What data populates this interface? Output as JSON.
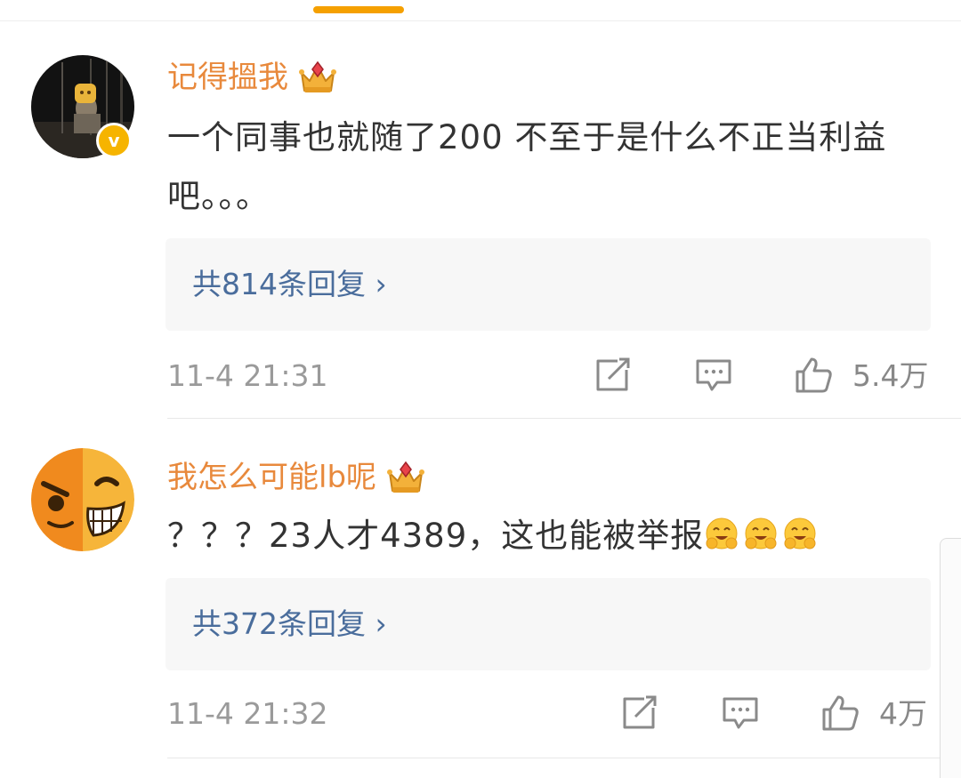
{
  "comments": [
    {
      "username": "记得搵我",
      "text": "一个同事也就随了200 不至于是什么不正当利益吧。。。",
      "replies_label": "共814条回复 ›",
      "timestamp": "11-4 21:31",
      "likes": "5.4万",
      "verified": true,
      "avatar": "dark-photo-avatar"
    },
    {
      "username": "我怎么可能lb呢",
      "text": "？？？23人才4389，这也能被举报",
      "emoji_count": 3,
      "replies_label": "共372条回复 ›",
      "timestamp": "11-4 21:32",
      "likes": "4万",
      "verified": false,
      "avatar": "grin-emoji-avatar"
    }
  ],
  "colors": {
    "username": "#e8893c",
    "reply_link": "#4a6d9c",
    "tab_indicator": "#f5a000",
    "meta_text": "#9a9a9a"
  },
  "icons": [
    "crown-icon",
    "verified-badge-icon",
    "repost-icon",
    "comment-icon",
    "like-icon",
    "chevron-right-icon",
    "hug-emoji-icon"
  ]
}
